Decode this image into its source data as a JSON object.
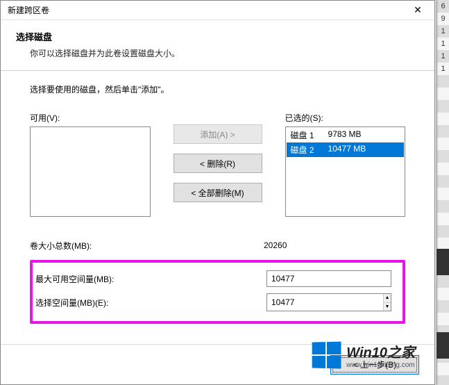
{
  "window": {
    "title": "新建跨区卷",
    "close": "✕"
  },
  "header": {
    "title": "选择磁盘",
    "subtitle": "你可以选择磁盘并为此卷设置磁盘大小。"
  },
  "instruction": "选择要使用的磁盘，然后单击\"添加\"。",
  "available": {
    "label": "可用(V):",
    "items": []
  },
  "selected": {
    "label": "已选的(S):",
    "items": [
      {
        "name": "磁盘 1",
        "size": "9783 MB",
        "selected": false
      },
      {
        "name": "磁盘 2",
        "size": "10477 MB",
        "selected": true
      }
    ]
  },
  "buttons": {
    "add": "添加(A) >",
    "remove": "< 删除(R)",
    "removeAll": "< 全部删除(M)",
    "back": "< 上一步(B)"
  },
  "fields": {
    "totalLabel": "卷大小总数(MB):",
    "totalValue": "20260",
    "maxLabel": "最大可用空间量(MB):",
    "maxValue": "10477",
    "selectLabel": "选择空间量(MB)(E):",
    "selectValue": "10477"
  },
  "watermark": {
    "line1": "Win10之家",
    "line2": "www.win10xitong.com"
  },
  "rightStrip": [
    "6",
    "9",
    "1",
    "1",
    "1",
    "1"
  ]
}
